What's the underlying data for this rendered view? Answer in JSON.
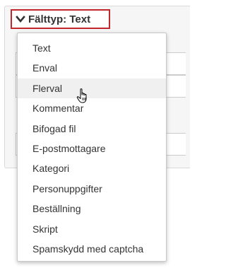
{
  "field_type": {
    "label": "Fälttyp: Text",
    "toggle_icon": "chevron-down-icon",
    "highlight_color": "#c1272d"
  },
  "menu": {
    "items": [
      {
        "label": "Text"
      },
      {
        "label": "Enval"
      },
      {
        "label": "Flerval",
        "hovered": true
      },
      {
        "label": "Kommentar"
      },
      {
        "label": "Bifogad fil"
      },
      {
        "label": "E-postmottagare"
      },
      {
        "label": "Kategori"
      },
      {
        "label": "Personuppgifter"
      },
      {
        "label": "Beställning"
      },
      {
        "label": "Skript"
      },
      {
        "label": "Spamskydd med captcha"
      }
    ],
    "hover_color": "#f0f0f0"
  },
  "cursor_icon": "hand-pointer-icon"
}
